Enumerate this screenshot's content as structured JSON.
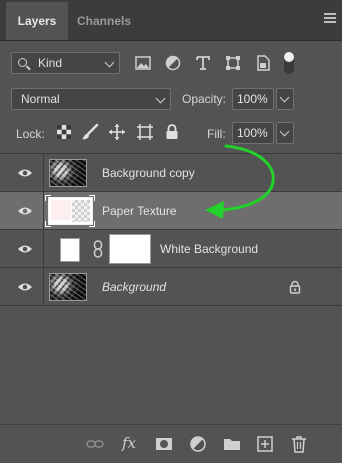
{
  "tabs": [
    {
      "label": "Layers",
      "active": true
    },
    {
      "label": "Channels",
      "active": false
    }
  ],
  "filter": {
    "kind_label": "Kind",
    "icons": [
      "image-filter-icon",
      "adjustment-filter-icon",
      "type-filter-icon",
      "shape-filter-icon",
      "smart-object-filter-icon",
      "filter-toggle-icon"
    ]
  },
  "blend": {
    "mode": "Normal",
    "opacity_label": "Opacity:",
    "opacity_value": "100%"
  },
  "lock": {
    "label": "Lock:",
    "icons": [
      "lock-transparent-icon",
      "lock-image-pixels-icon",
      "lock-position-icon",
      "lock-artboard-icon",
      "lock-all-icon"
    ],
    "fill_label": "Fill:",
    "fill_value": "100%"
  },
  "layers": [
    {
      "name": "Background copy",
      "visible": true,
      "selected": false
    },
    {
      "name": "Paper Texture",
      "visible": true,
      "selected": true
    },
    {
      "name": "White Background",
      "visible": true,
      "selected": false
    },
    {
      "name": "Background",
      "visible": true,
      "selected": false,
      "locked": true
    }
  ],
  "colors": {
    "panel_bg": "#535353",
    "selected_row": "#6e6e6e",
    "annotation_arrow": "#22d12a"
  },
  "bottom_toolbar": [
    "link-layers-icon",
    "fx-icon",
    "add-mask-icon",
    "adjustment-layer-icon",
    "group-folder-icon",
    "new-layer-icon",
    "trash-icon"
  ],
  "bottom_fx_label": "fx"
}
